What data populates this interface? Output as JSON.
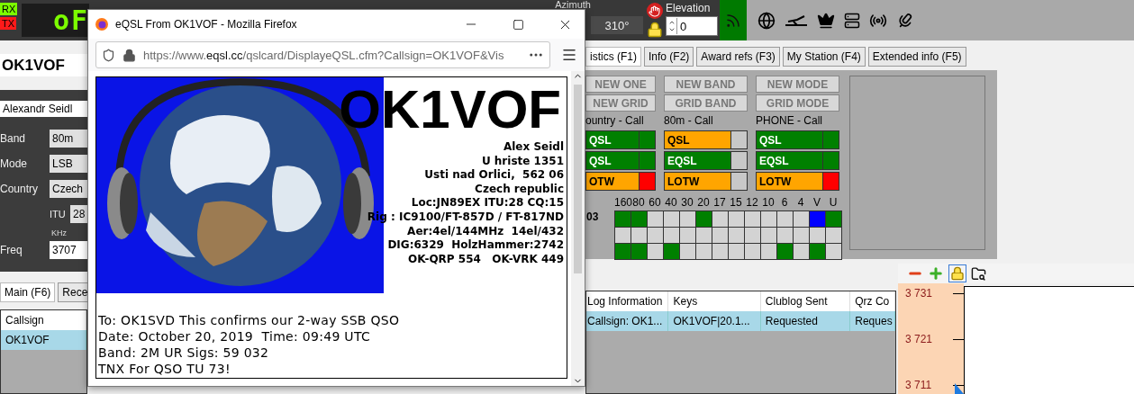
{
  "top_bar": {
    "rx": "RX",
    "tx": "TX",
    "display": "oF",
    "azimuth_label": "Azimuth",
    "azimuth": "310°",
    "elevation_label": "Elevation",
    "elevation": "0"
  },
  "station": {
    "callsign": "OK1VOF",
    "name": "Alexandr Seidl",
    "fields": [
      {
        "label": "Band",
        "value": "80m"
      },
      {
        "label": "Mode",
        "value": "LSB"
      },
      {
        "label": "Country",
        "value": "Czech"
      }
    ],
    "itu_label": "ITU",
    "itu": "28",
    "freq_unit": "KHz",
    "freq_label": "Freq",
    "freq": "3707"
  },
  "left_tabs": [
    {
      "label": "Main (F6)",
      "selected": true
    },
    {
      "label": "Rece",
      "selected": false
    }
  ],
  "left_table": {
    "columns": [
      "Callsign"
    ],
    "rows": [
      {
        "cells": [
          "OK1VOF"
        ],
        "selected": true
      }
    ]
  },
  "info_tabs": [
    {
      "label": "istics (F1)",
      "selected": true
    },
    {
      "label": "Info (F2)",
      "selected": false
    },
    {
      "label": "Award refs (F3)",
      "selected": false
    },
    {
      "label": "My Station (F4)",
      "selected": false
    },
    {
      "label": "Extended info (F5)",
      "selected": false
    }
  ],
  "status_columns": [
    {
      "buttons": [
        "NEW ONE",
        "NEW GRID"
      ],
      "title": "ountry - Call",
      "rows": [
        {
          "label": "QSL",
          "color": "#008000",
          "flag": {
            "color": "#008000"
          }
        },
        {
          "label": "QSL",
          "color": "#008000",
          "flag": {
            "color": "#008000"
          }
        },
        {
          "label": "OTW",
          "color": "#ffa500",
          "flag": {
            "color": "#ff0000"
          }
        }
      ]
    },
    {
      "buttons": [
        "NEW BAND",
        "GRID BAND"
      ],
      "title": "80m - Call",
      "rows": [
        {
          "label": "QSL",
          "color": "#ffa500",
          "flag": {
            "color": "#c8c8c8"
          }
        },
        {
          "label": "EQSL",
          "color": "#008000",
          "flag": {
            "color": "#c8c8c8"
          }
        },
        {
          "label": "LOTW",
          "color": "#ffa500",
          "flag": {
            "color": "#c8c8c8"
          }
        }
      ]
    },
    {
      "buttons": [
        "NEW MODE",
        "GRID MODE"
      ],
      "title": "PHONE - Call",
      "rows": [
        {
          "label": "QSL",
          "color": "#008000",
          "flag": {
            "color": "#008000"
          }
        },
        {
          "label": "EQSL",
          "color": "#008000",
          "flag": {
            "color": "#008000"
          }
        },
        {
          "label": "LOTW",
          "color": "#ffa500",
          "flag": {
            "color": "#ff0000"
          }
        }
      ]
    }
  ],
  "band_grid": {
    "bands": [
      "160",
      "80",
      "60",
      "40",
      "30",
      "20",
      "17",
      "15",
      "12",
      "10",
      "6",
      "4",
      "V",
      "U"
    ],
    "rows": [
      {
        "label": "03",
        "cells": [
          {
            "color": "#008000"
          },
          {
            "color": "#008000"
          },
          {
            "color": "#d3d3d3"
          },
          {
            "color": "#d3d3d3"
          },
          {
            "color": "#d3d3d3"
          },
          {
            "color": "#008000"
          },
          {
            "color": "#d3d3d3"
          },
          {
            "color": "#d3d3d3"
          },
          {
            "color": "#d3d3d3"
          },
          {
            "color": "#d3d3d3"
          },
          {
            "color": "#d3d3d3"
          },
          {
            "color": "#d3d3d3"
          },
          {
            "color": "#0000ff"
          },
          {
            "color": "#008000"
          }
        ]
      },
      {
        "cells": [
          {
            "color": "#d3d3d3"
          },
          {
            "color": "#d3d3d3"
          },
          {
            "color": "#d3d3d3"
          },
          {
            "color": "#d3d3d3"
          },
          {
            "color": "#d3d3d3"
          },
          {
            "color": "#d3d3d3"
          },
          {
            "color": "#d3d3d3"
          },
          {
            "color": "#d3d3d3"
          },
          {
            "color": "#d3d3d3"
          },
          {
            "color": "#d3d3d3"
          },
          {
            "color": "#d3d3d3"
          },
          {
            "color": "#d3d3d3"
          },
          {
            "color": "#d3d3d3"
          },
          {
            "color": "#d3d3d3"
          }
        ]
      },
      {
        "cells": [
          {
            "color": "#008000"
          },
          {
            "color": "#008000"
          },
          {
            "color": "#d3d3d3"
          },
          {
            "color": "#008000"
          },
          {
            "color": "#d3d3d3"
          },
          {
            "color": "#d3d3d3"
          },
          {
            "color": "#d3d3d3"
          },
          {
            "color": "#d3d3d3"
          },
          {
            "color": "#d3d3d3"
          },
          {
            "color": "#d3d3d3"
          },
          {
            "color": "#008000"
          },
          {
            "color": "#d3d3d3"
          },
          {
            "color": "#008000"
          },
          {
            "color": "#d3d3d3"
          }
        ]
      }
    ]
  },
  "log_table": {
    "columns": [
      "Log Information",
      "Keys",
      "Clublog Sent",
      "Qrz Co"
    ],
    "rows": [
      {
        "cells": [
          "Callsign: OK1...",
          "OK1VOF|20.1...",
          "Requested",
          "Reques"
        ],
        "selected": true
      }
    ]
  },
  "bandmap": {
    "lock_pressed": true,
    "ticks": [
      "3 731",
      "3 721",
      "3 711"
    ]
  },
  "browser": {
    "title": "eQSL From OK1VOF - Mozilla Firefox",
    "url": "https://www.**eqsl.cc**/qslcard/DisplayeQSL.cfm?Callsign=OK1VOF&Vis",
    "card": {
      "callsign": "OK1VOF",
      "address": [
        "Alex Seidl",
        "U hriste 1351",
        "Usti nad Orlici,  562 06",
        "Czech republic",
        "Loc:JN89EX ITU:28 CQ:15",
        "Rig : IC9100/FT-857D / FT-817ND",
        "Aer:4el/144MHz  14el/432",
        "DIG:6329  HolzHammer:2742",
        "OK-QRP 554   OK-VRK 449"
      ],
      "message": [
        "To: OK1SVD This confirms our 2-way SSB QSO",
        "Date: October 20, 2019  Time: 09:49 UTC",
        "Band: 2M UR Sigs: 59 032",
        "TNX For QSO TU 73!"
      ]
    }
  }
}
